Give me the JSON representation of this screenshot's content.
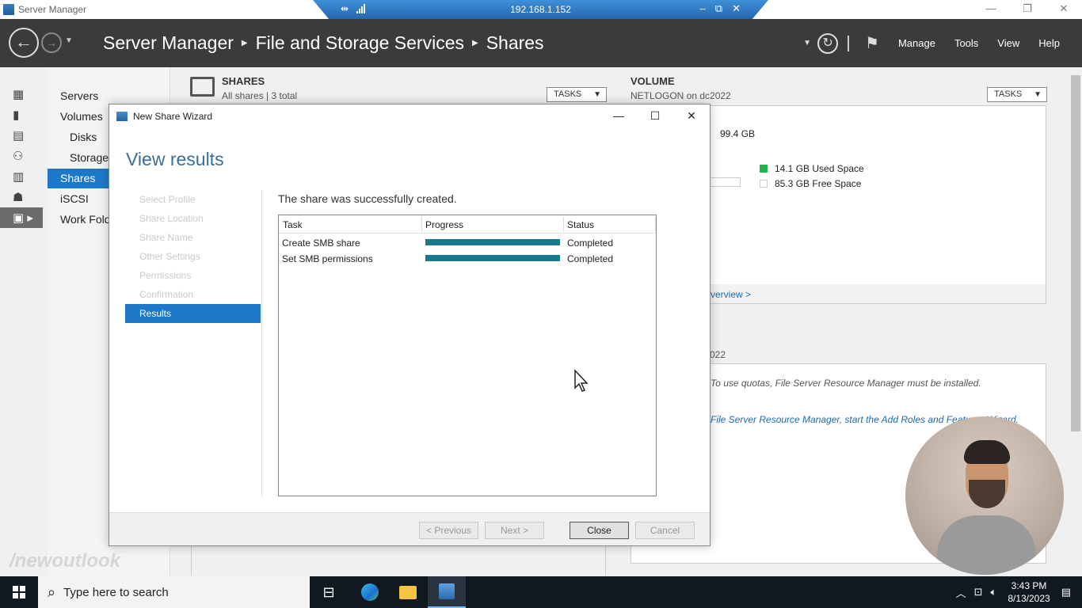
{
  "window": {
    "title": "Server Manager",
    "controls": [
      "—",
      "❐",
      "✕"
    ]
  },
  "rdp": {
    "ip": "192.168.1.152",
    "controls": [
      "–",
      "⧉",
      "✕"
    ]
  },
  "header": {
    "breadcrumb": [
      "Server Manager",
      "File and Storage Services",
      "Shares"
    ],
    "menu": [
      "Manage",
      "Tools",
      "View",
      "Help"
    ]
  },
  "left_nav": {
    "items": [
      {
        "label": "Servers"
      },
      {
        "label": "Volumes"
      },
      {
        "label": "Disks"
      },
      {
        "label": "Storage"
      },
      {
        "label": "Shares"
      },
      {
        "label": "iSCSI"
      },
      {
        "label": "Work Fold"
      }
    ]
  },
  "shares": {
    "title": "SHARES",
    "subtitle": "All shares | 3 total",
    "tasks": "TASKS"
  },
  "volume": {
    "title": "VOLUME",
    "subtitle": "NETLOGON on dc2022",
    "tasks": "TASKS",
    "capacity": "99.4 GB",
    "used": "14.1 GB Used Space",
    "free": "85.3 GB Free Space",
    "overview_link": "verview >",
    "used_color": "#22b14c"
  },
  "quota": {
    "label": "022",
    "text1": "To use quotas, File Server Resource Manager must be installed.",
    "text2": "File Server Resource Manager, start the Add Roles and Features Wizard."
  },
  "wizard": {
    "title": "New Share Wizard",
    "heading": "View results",
    "steps": [
      "Select Profile",
      "Share Location",
      "Share Name",
      "Other Settings",
      "Permissions",
      "Confirmation",
      "Results"
    ],
    "active_step": "Results",
    "message": "The share was successfully created.",
    "columns": [
      "Task",
      "Progress",
      "Status"
    ],
    "rows": [
      {
        "task": "Create SMB share",
        "progress": 1.0,
        "status": "Completed"
      },
      {
        "task": "Set SMB permissions",
        "progress": 1.0,
        "status": "Completed"
      }
    ],
    "buttons": {
      "previous": "< Previous",
      "next": "Next >",
      "close": "Close",
      "cancel": "Cancel"
    }
  },
  "watermark": "/newoutlook",
  "taskbar": {
    "search_placeholder": "Type here to search",
    "time": "3:43 PM",
    "date": "8/13/2023"
  }
}
